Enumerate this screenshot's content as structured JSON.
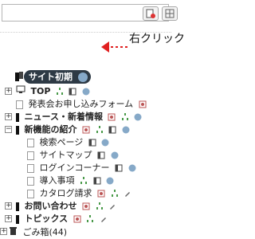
{
  "toolbar": {
    "search_placeholder": ""
  },
  "root": {
    "label": "サイト初期"
  },
  "callout": {
    "label": "右クリック",
    "color": "#e02020"
  },
  "tree": [
    {
      "label": "TOP",
      "bold": true
    },
    {
      "label": "発表会お申し込みフォーム",
      "bold": false
    },
    {
      "label": "ニュース・新着情報",
      "bold": true
    },
    {
      "label": "新機能の紹介",
      "bold": true
    },
    {
      "label": "検索ページ",
      "bold": false
    },
    {
      "label": "サイトマップ",
      "bold": false
    },
    {
      "label": "ログインコーナー",
      "bold": false
    },
    {
      "label": "導入事項",
      "bold": false
    },
    {
      "label": "カタログ請求",
      "bold": false
    },
    {
      "label": "お問い合わせ",
      "bold": true
    },
    {
      "label": "トピックス",
      "bold": true
    }
  ],
  "trash": {
    "label": "ごみ箱(44)"
  }
}
